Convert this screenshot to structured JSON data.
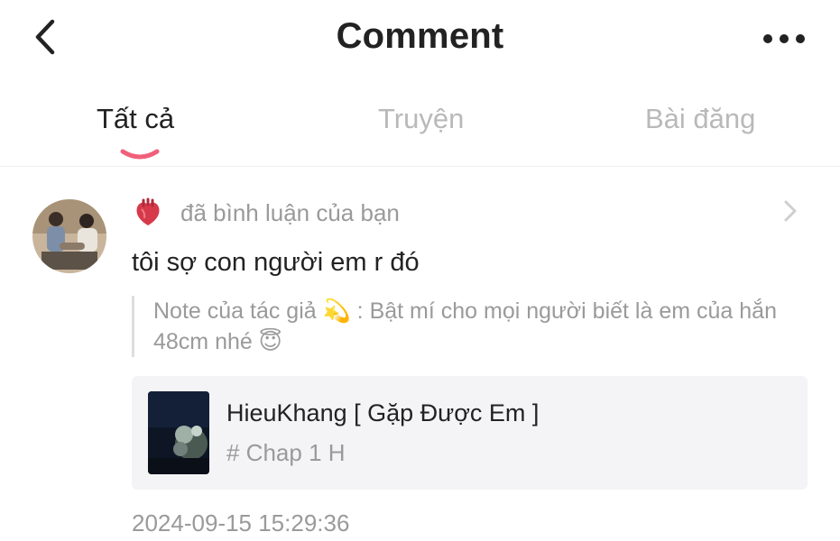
{
  "header": {
    "title": "Comment",
    "back_icon": "chevron-left-icon",
    "more_icon": "more-dots-icon"
  },
  "tabs": [
    {
      "label": "Tất cả",
      "active": true
    },
    {
      "label": "Truyện",
      "active": false
    },
    {
      "label": "Bài đăng",
      "active": false
    }
  ],
  "colors": {
    "accent": "#f0607a",
    "text_primary": "#222222",
    "text_muted": "#9a9a9a",
    "card_bg": "#f4f4f6"
  },
  "notification": {
    "activity_icon": "heart-icon",
    "activity_text": "đã bình luận của bạn",
    "comment_text": "tôi sợ con người em r đó",
    "quote_text": "Note của tác giả 💫 : Bật mí cho mọi người biết là em của hắn 48cm nhé 😇",
    "story": {
      "title": "HieuKhang [ Gặp Được Em ]",
      "chapter": "# Chap 1 H"
    },
    "timestamp": "2024-09-15 15:29:36"
  }
}
